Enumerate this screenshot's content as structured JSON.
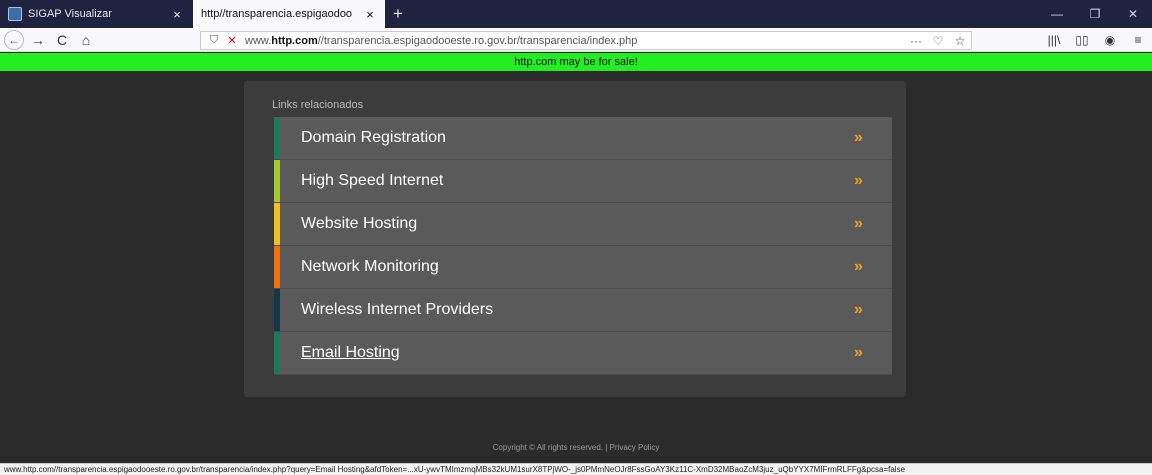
{
  "browser": {
    "tabs": [
      {
        "title": "SIGAP Visualizar",
        "close": "×"
      },
      {
        "title": "http//transparencia.espigaodoo",
        "close": "×"
      }
    ],
    "new_tab": "+",
    "window_controls": {
      "minimize": "—",
      "restore": "❐",
      "close": "✕"
    },
    "nav": {
      "back": "←",
      "forward": "→",
      "reload": "C",
      "home": "⌂"
    },
    "url_prefix": "www.",
    "url_domain": "http.com",
    "url_rest": "//transparencia.espigaodooeste.ro.gov.br/transparencia/index.php",
    "url_dots": "···",
    "url_pocket": "♡",
    "url_star": "☆",
    "right_icons": {
      "library": "|||\\",
      "sidebar": "▯▯",
      "account": "◉",
      "menu": "≡"
    }
  },
  "banner": {
    "text": "http.com may be for sale!"
  },
  "panel": {
    "title": "Links relacionados",
    "links": [
      {
        "label": "Domain Registration",
        "arrow": "»",
        "color": "#1a7a5a"
      },
      {
        "label": "High Speed Internet",
        "arrow": "»",
        "color": "#a8c832"
      },
      {
        "label": "Website Hosting",
        "arrow": "»",
        "color": "#f0c020"
      },
      {
        "label": "Network Monitoring",
        "arrow": "»",
        "color": "#f07010"
      },
      {
        "label": "Wireless Internet Providers",
        "arrow": "»",
        "color": "#103848"
      },
      {
        "label": "Email Hosting",
        "arrow": "»",
        "color": "#1a7a5a"
      }
    ]
  },
  "footer": {
    "text": "Copyright © All rights reserved.  |  Privacy Policy"
  },
  "status_url": "www.http.com//transparencia.espigaodooeste.ro.gov.br/transparencia/index.php?query=Email Hosting&afdToken=...xU-ywvTMImzmqMBs32kUM1surX8TPjWO-_js0PMmNeOJr8FssGoAY3Kz11C-XmD32MBaoZcM3juz_uQbYYX7MIFrmRLFFg&pcsa=false"
}
